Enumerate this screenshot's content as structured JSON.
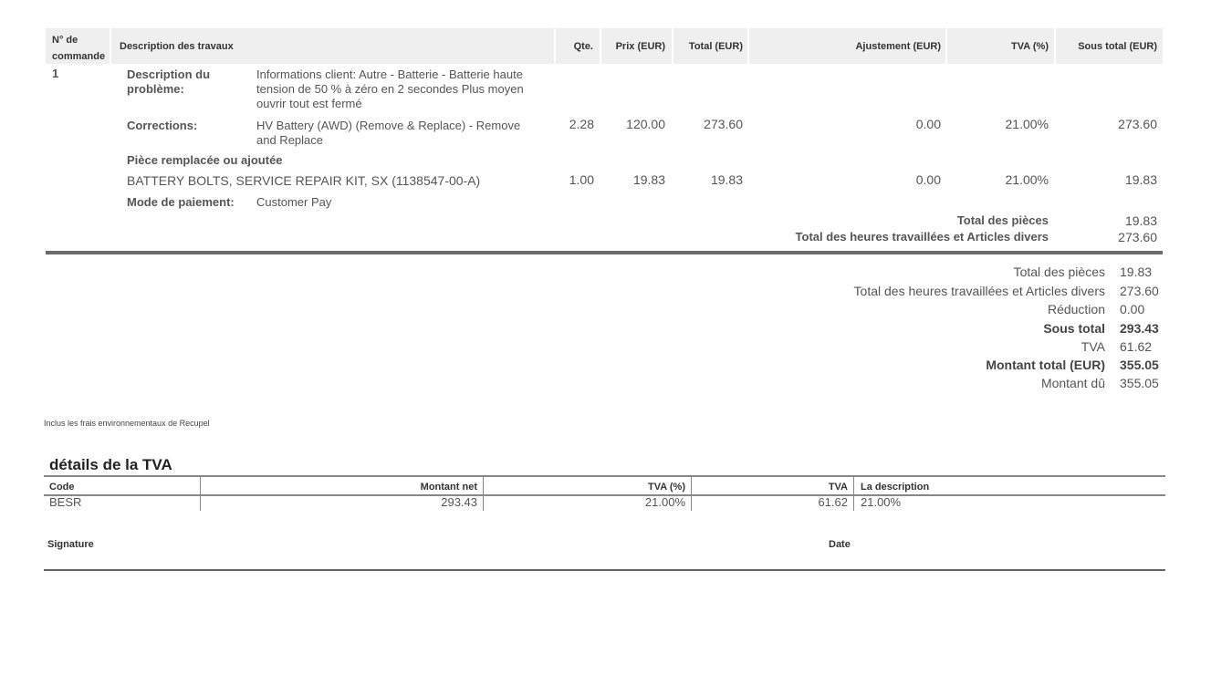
{
  "table": {
    "headers": {
      "order_no": "N° de commande",
      "description": "Description des travaux",
      "qty": "Qte.",
      "price": "Prix (EUR)",
      "total": "Total (EUR)",
      "adjustment": "Ajustement (EUR)",
      "vat_pct": "TVA (%)",
      "subtotal": "Sous total (EUR)"
    },
    "order_number": "1",
    "problem_label": "Description du problème:",
    "problem_text": "Informations client: Autre - Batterie - Batterie haute tension de 50 % à zéro en 2 secondes Plus moyen ouvrir tout est fermé",
    "corrections_label": "Corrections:",
    "corrections_text": "HV Battery (AWD) (Remove & Replace) - Remove and Replace",
    "corrections_values": {
      "qty": "2.28",
      "price": "120.00",
      "total": "273.60",
      "adjustment": "0.00",
      "vat": "21.00%",
      "subtotal": "273.60"
    },
    "part_label": "Pièce remplacée ou ajoutée",
    "part_text": "BATTERY BOLTS, SERVICE REPAIR KIT, SX (1138547-00-A)",
    "part_values": {
      "qty": "1.00",
      "price": "19.83",
      "total": "19.83",
      "adjustment": "0.00",
      "vat": "21.00%",
      "subtotal": "19.83"
    },
    "payment_label": "Mode de paiement:",
    "payment_text": "Customer Pay",
    "order_totals": [
      {
        "label": "Total des pièces",
        "value": "19.83"
      },
      {
        "label": "Total des heures travaillées et Articles divers",
        "value": "273.60"
      }
    ]
  },
  "summary": [
    {
      "label": "Total des pièces",
      "value": "19.83"
    },
    {
      "label": "Total des heures travaillées et Articles divers",
      "value": "273.60"
    },
    {
      "label": "Réduction",
      "value": "0.00"
    },
    {
      "label": "Sous total",
      "value": "293.43"
    },
    {
      "label": "TVA",
      "value": "61.62"
    },
    {
      "label": "Montant total (EUR)",
      "value": "355.05"
    },
    {
      "label": "Montant dû",
      "value": "355.05"
    }
  ],
  "recupel_note": "Inclus les frais environnementaux de Recupel",
  "vat_details": {
    "title": "détails de la TVA",
    "headers": {
      "code": "Code",
      "net": "Montant net",
      "vat_pct": "TVA (%)",
      "vat": "TVA",
      "description": "La description"
    },
    "row": {
      "code": "BESR",
      "net": "293.43",
      "vat_pct": "21.00%",
      "vat": "61.62",
      "description": "21.00%"
    }
  },
  "signature_label": "Signature",
  "date_label": "Date"
}
